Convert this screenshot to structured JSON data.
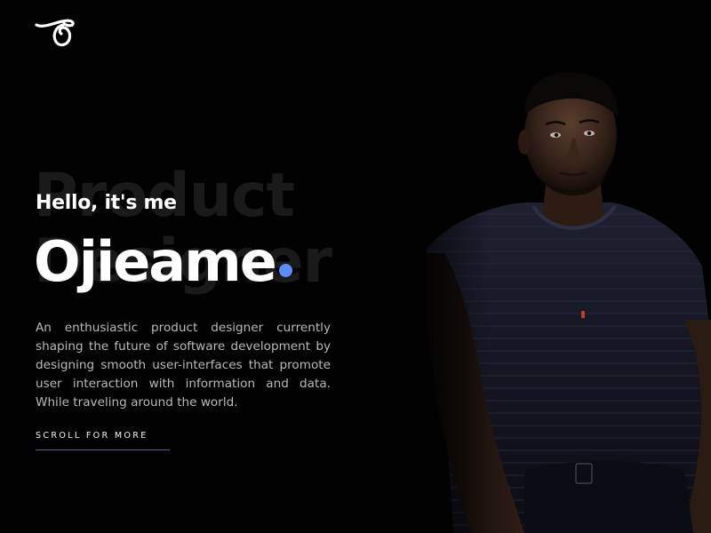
{
  "logo": {
    "icon": "script-o-logo-icon"
  },
  "hero": {
    "watermark_line1": "Product",
    "watermark_line2": "Designer",
    "greeting": "Hello, it's me",
    "name": "Ojieame",
    "intro": "An enthusiastic product designer currently shaping the future of software development by designing smooth user-interfaces that promote user interaction with information and data. While traveling around the world.",
    "scroll_label": "SCROLL FOR MORE"
  },
  "colors": {
    "background": "#020202",
    "accent_dot": "#5a8cff",
    "scroll_underline": "#5d5d8e",
    "body_text": "#b9b9b9"
  },
  "portrait": {
    "subject": "photo of designer in dark t-shirt"
  }
}
